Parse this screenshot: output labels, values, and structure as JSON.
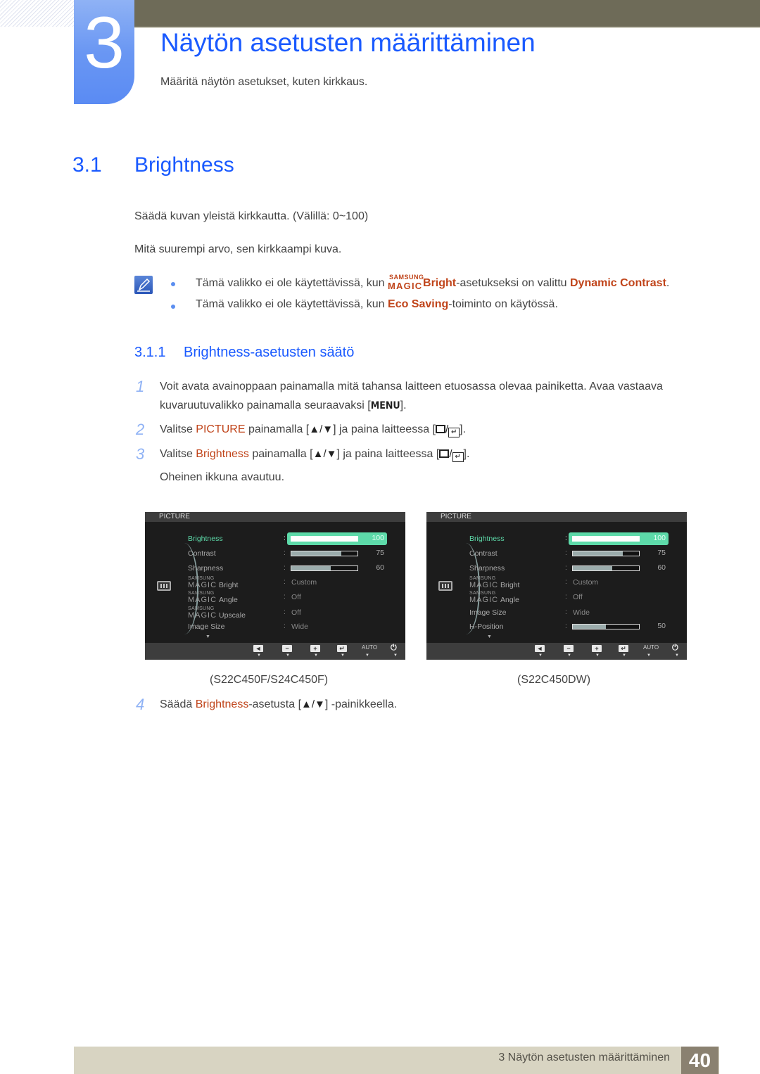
{
  "chapter": {
    "number": "3",
    "title": "Näytön asetusten määrittäminen",
    "subtitle": "Määritä näytön asetukset, kuten kirkkaus."
  },
  "section": {
    "number": "3.1",
    "title": "Brightness",
    "paragraphs": [
      "Säädä kuvan yleistä kirkkautta. (Välillä: 0~100)",
      "Mitä suurempi arvo, sen kirkkaampi kuva."
    ]
  },
  "notes": {
    "icon": "note-pencil-icon",
    "items": [
      {
        "pre": "Tämä valikko ei ole käytettävissä, kun ",
        "magic_top": "SAMSUNG",
        "magic_bottom": "MAGIC",
        "highlight1": "Bright",
        "mid": "-asetukseksi on valittu ",
        "highlight2": "Dynamic Contrast",
        "post": "."
      },
      {
        "pre": "Tämä valikko ei ole käytettävissä, kun ",
        "highlight1": "Eco Saving",
        "post": "-toiminto on käytössä."
      }
    ]
  },
  "subsection": {
    "number": "3.1.1",
    "title": "Brightness-asetusten säätö"
  },
  "steps": [
    {
      "num": "1",
      "line1": "Voit avata avainoppaan painamalla mitä tahansa laitteen etuosassa olevaa painiketta. Avaa vastaava",
      "line2_pre": "kuvaruutuvalikko painamalla seuraavaksi [",
      "key": "MENU",
      "line2_post": "]."
    },
    {
      "num": "2",
      "pre": "Valitse ",
      "highlight": "PICTURE",
      "mid": " painamalla [",
      "arrows": "▲/▼",
      "mid2": "] ja paina laitteessa [",
      "post": "]."
    },
    {
      "num": "3",
      "pre": "Valitse ",
      "highlight": "Brightness",
      "mid": " painamalla [",
      "arrows": "▲/▼",
      "mid2": "] ja paina laitteessa [",
      "post": "].",
      "after": "Oheinen ikkuna avautuu."
    },
    {
      "num": "4",
      "pre": "Säädä ",
      "highlight": "Brightness",
      "mid": "-asetusta [",
      "arrows": "▲/▼",
      "post": "] -painikkeella."
    }
  ],
  "osd_left": {
    "header": "PICTURE",
    "caption": "(S22C450F/S24C450F)",
    "rows": [
      {
        "label": "Brightness",
        "type": "bar",
        "value": 100,
        "active": true
      },
      {
        "label": "Contrast",
        "type": "bar",
        "value": 75
      },
      {
        "label": "Sharpness",
        "type": "bar",
        "value": 60
      },
      {
        "magic_top": "SAMSUNG",
        "magic_bottom": "MAGIC",
        "label": "Bright",
        "type": "text",
        "value": "Custom"
      },
      {
        "magic_top": "SAMSUNG",
        "magic_bottom": "MAGIC",
        "label": "Angle",
        "type": "text",
        "value": "Off"
      },
      {
        "magic_top": "SAMSUNG",
        "magic_bottom": "MAGIC",
        "label": "Upscale",
        "type": "text",
        "value": "Off"
      },
      {
        "label": "Image Size",
        "type": "text",
        "value": "Wide"
      }
    ],
    "more": "▼",
    "buttons": [
      {
        "icon": "left-arrow-icon",
        "glyph": "◄"
      },
      {
        "icon": "minus-icon",
        "glyph": "−"
      },
      {
        "icon": "plus-icon",
        "glyph": "+"
      },
      {
        "icon": "enter-icon",
        "glyph": "↵"
      },
      {
        "icon": "auto-label",
        "text": "AUTO"
      },
      {
        "icon": "power-icon",
        "glyph": "⏻"
      }
    ]
  },
  "osd_right": {
    "header": "PICTURE",
    "caption": "(S22C450DW)",
    "rows": [
      {
        "label": "Brightness",
        "type": "bar",
        "value": 100,
        "active": true
      },
      {
        "label": "Contrast",
        "type": "bar",
        "value": 75
      },
      {
        "label": "Sharpness",
        "type": "bar",
        "value": 60
      },
      {
        "magic_top": "SAMSUNG",
        "magic_bottom": "MAGIC",
        "label": "Bright",
        "type": "text",
        "value": "Custom"
      },
      {
        "magic_top": "SAMSUNG",
        "magic_bottom": "MAGIC",
        "label": "Angle",
        "type": "text",
        "value": "Off"
      },
      {
        "label": "Image Size",
        "type": "text",
        "value": "Wide"
      },
      {
        "label": "H-Position",
        "type": "bar",
        "value": 50
      }
    ],
    "more": "▼",
    "buttons": [
      {
        "icon": "left-arrow-icon",
        "glyph": "◄"
      },
      {
        "icon": "minus-icon",
        "glyph": "−"
      },
      {
        "icon": "plus-icon",
        "glyph": "+"
      },
      {
        "icon": "enter-icon",
        "glyph": "↵"
      },
      {
        "icon": "auto-label",
        "text": "AUTO"
      },
      {
        "icon": "power-icon",
        "glyph": "⏻"
      }
    ]
  },
  "footer": {
    "title": "3 Näytön asetusten määrittäminen",
    "page": "40"
  },
  "colors": {
    "heading_blue": "#1a5aff",
    "highlight_orange": "#c0441a",
    "osd_active_green": "#5ddaa9",
    "top_bar": "#6e6b58",
    "footer_bar": "#d8d4c2",
    "page_box": "#8a8170"
  }
}
